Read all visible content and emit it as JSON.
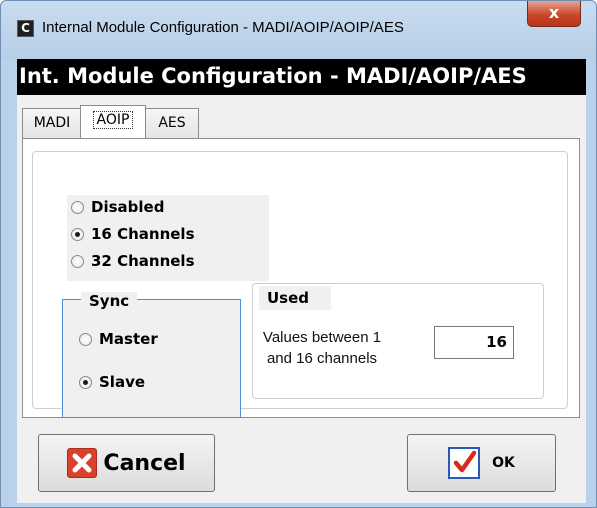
{
  "window": {
    "title": "Internal Module Configuration - MADI/AOIP/AOIP/AES",
    "app_icon_letter": "C",
    "close_glyph": "x"
  },
  "heading": "Int. Module Configuration - MADI/AOIP/AES",
  "tabs": [
    {
      "label": "MADI",
      "active": false
    },
    {
      "label": "AOIP",
      "active": true
    },
    {
      "label": "AES",
      "active": false
    }
  ],
  "aoip": {
    "modes": [
      {
        "label": "Disabled",
        "checked": false
      },
      {
        "label": "16 Channels",
        "checked": true
      },
      {
        "label": "32 Channels",
        "checked": false
      }
    ],
    "sync": {
      "title": "Sync",
      "options": [
        {
          "label": "Master",
          "checked": false
        },
        {
          "label": "Slave",
          "checked": true
        }
      ]
    },
    "used": {
      "title": "Used",
      "description": "Values between 1 and 16 channels",
      "value": "16"
    }
  },
  "buttons": {
    "cancel_label": "Cancel",
    "ok_label": "OK"
  },
  "icons": {
    "cancel": "close-x-icon",
    "ok": "checkmark-icon"
  },
  "colors": {
    "heading_bg": "#000000",
    "cancel_icon": "#d9412c",
    "ok_check": "#d9291c",
    "ok_frame": "#2a58b8",
    "sync_border": "#4a90d9"
  }
}
